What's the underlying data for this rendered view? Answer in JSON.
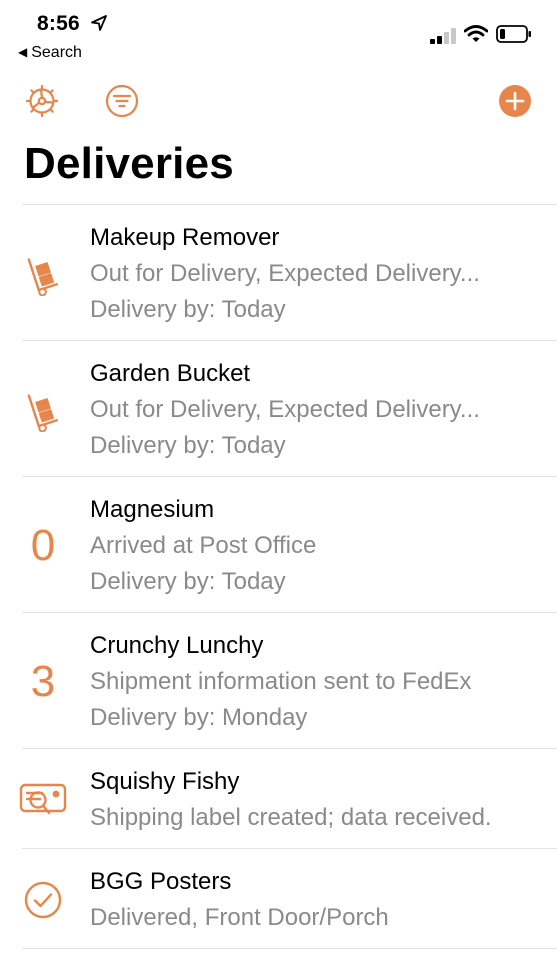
{
  "status_bar": {
    "time": "8:56",
    "back_label": "Search"
  },
  "toolbar": {
    "settings_icon": "settings-gear-icon",
    "filter_icon": "filter-icon",
    "add_icon": "add-icon"
  },
  "title": "Deliveries",
  "accent_color": "#e8854a",
  "deliveries": [
    {
      "name": "Makeup Remover",
      "status": "Out for Delivery, Expected Delivery...",
      "delivery_by": "Delivery by: Today",
      "icon": "hand-truck-icon"
    },
    {
      "name": "Garden Bucket",
      "status": "Out for Delivery, Expected Delivery...",
      "delivery_by": "Delivery by: Today",
      "icon": "hand-truck-icon"
    },
    {
      "name": "Magnesium",
      "status": "Arrived at Post Office",
      "delivery_by": "Delivery by: Today",
      "days": "0"
    },
    {
      "name": "Crunchy Lunchy",
      "status": "Shipment information sent to FedEx",
      "delivery_by": "Delivery by: Monday",
      "days": "3"
    },
    {
      "name": "Squishy Fishy",
      "status": "Shipping label created; data received.",
      "icon": "shipping-label-icon"
    },
    {
      "name": "BGG Posters",
      "status": "Delivered, Front Door/Porch",
      "icon": "checkmark-circle-icon"
    }
  ]
}
